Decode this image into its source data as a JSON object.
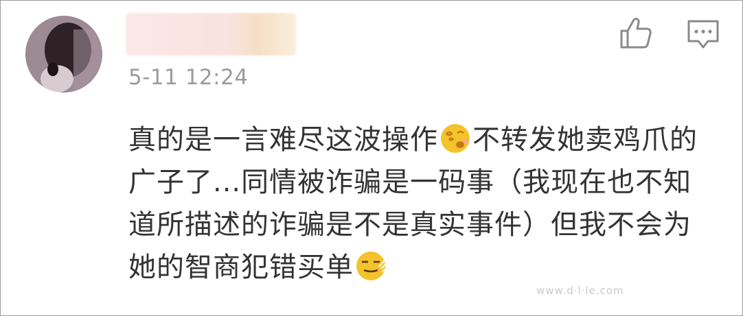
{
  "comment": {
    "username": "",
    "timestamp": "5-11 12:24",
    "text_part1": "真的是一言难尽这波操作",
    "text_part2": "不转发她卖鸡爪的广子了...同情被诈骗是一码事（我现在也不知道所描述的诈骗是不是真实事件）但我不会为她的智商犯错买单",
    "emoji1": "dizzy-face-emoji",
    "emoji2": "grimace-face-emoji"
  },
  "actions": {
    "like_icon": "thumbs-up-icon",
    "comment_icon": "comment-bubble-icon"
  },
  "watermark": "www.d·l·le.com",
  "colors": {
    "text": "#333333",
    "timestamp": "#9b9b9b",
    "icon": "#8a8a8a",
    "emoji": "#f4c22b"
  }
}
